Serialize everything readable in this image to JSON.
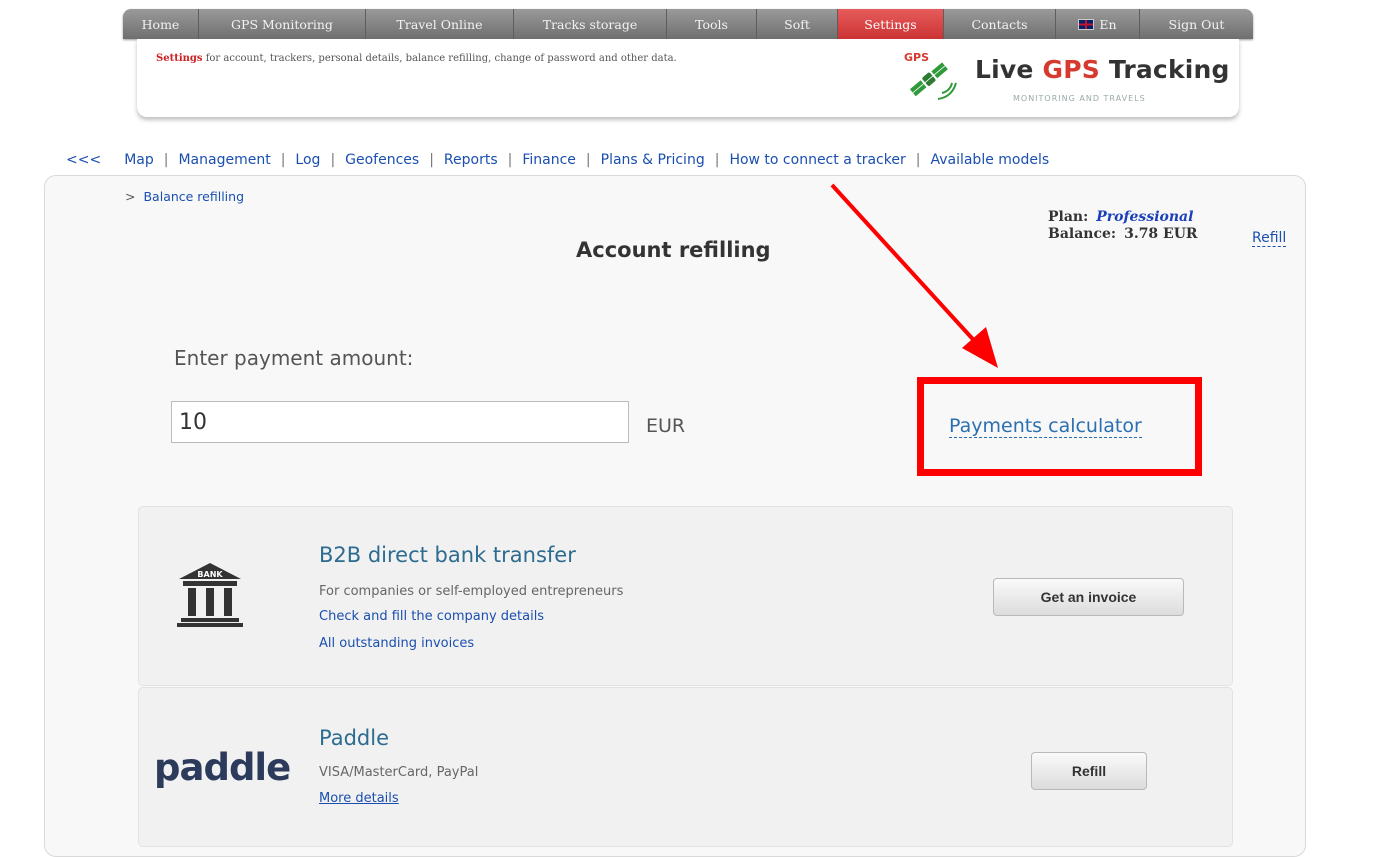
{
  "nav": {
    "items": [
      "Home",
      "GPS Monitoring",
      "Travel Online",
      "Tracks storage",
      "Tools",
      "Soft",
      "Settings",
      "Contacts",
      "En",
      "Sign Out"
    ],
    "active": "Settings"
  },
  "header": {
    "subtitle_bold": "Settings",
    "subtitle_rest": " for account, trackers, personal details, balance refilling, change of password and other data.",
    "logo_gps_small": "GPS",
    "logo_prefix": "Live ",
    "logo_gps": "GPS",
    "logo_suffix": " Tracking",
    "logo_tagline": "MONITORING AND TRAVELS"
  },
  "subnav": {
    "back": "<<<",
    "items": [
      "Map",
      "Management",
      "Log",
      "Geofences",
      "Reports",
      "Finance",
      "Plans & Pricing",
      "How to connect a tracker",
      "Available models"
    ]
  },
  "breadcrumb": {
    "marker": ">",
    "label": "Balance refilling"
  },
  "page": {
    "title": "Account refilling"
  },
  "account": {
    "plan_label": "Plan:",
    "plan_name": "Professional",
    "balance_label": "Balance:",
    "balance_value": "3.78 EUR",
    "refill_link": "Refill"
  },
  "payment": {
    "amount_label": "Enter payment amount:",
    "amount_value": "10",
    "currency": "EUR",
    "calculator_link": "Payments calculator"
  },
  "methods": [
    {
      "name": "B2B direct bank transfer",
      "description": "For companies or self-employed entrepreneurs",
      "links": [
        "Check and fill the company details",
        "All outstanding invoices"
      ],
      "button": "Get an invoice",
      "icon": "bank-icon",
      "icon_text": "BANK"
    },
    {
      "name": "Paddle",
      "description": "VISA/MasterCard, PayPal",
      "links": [
        "More details"
      ],
      "button": "Refill",
      "logo_text": "paddle"
    }
  ],
  "colors": {
    "nav_bg": "#7f7f7f",
    "nav_active": "#d9443f",
    "annotation_red": "#ff0000",
    "link_blue": "#1a4fb0"
  }
}
